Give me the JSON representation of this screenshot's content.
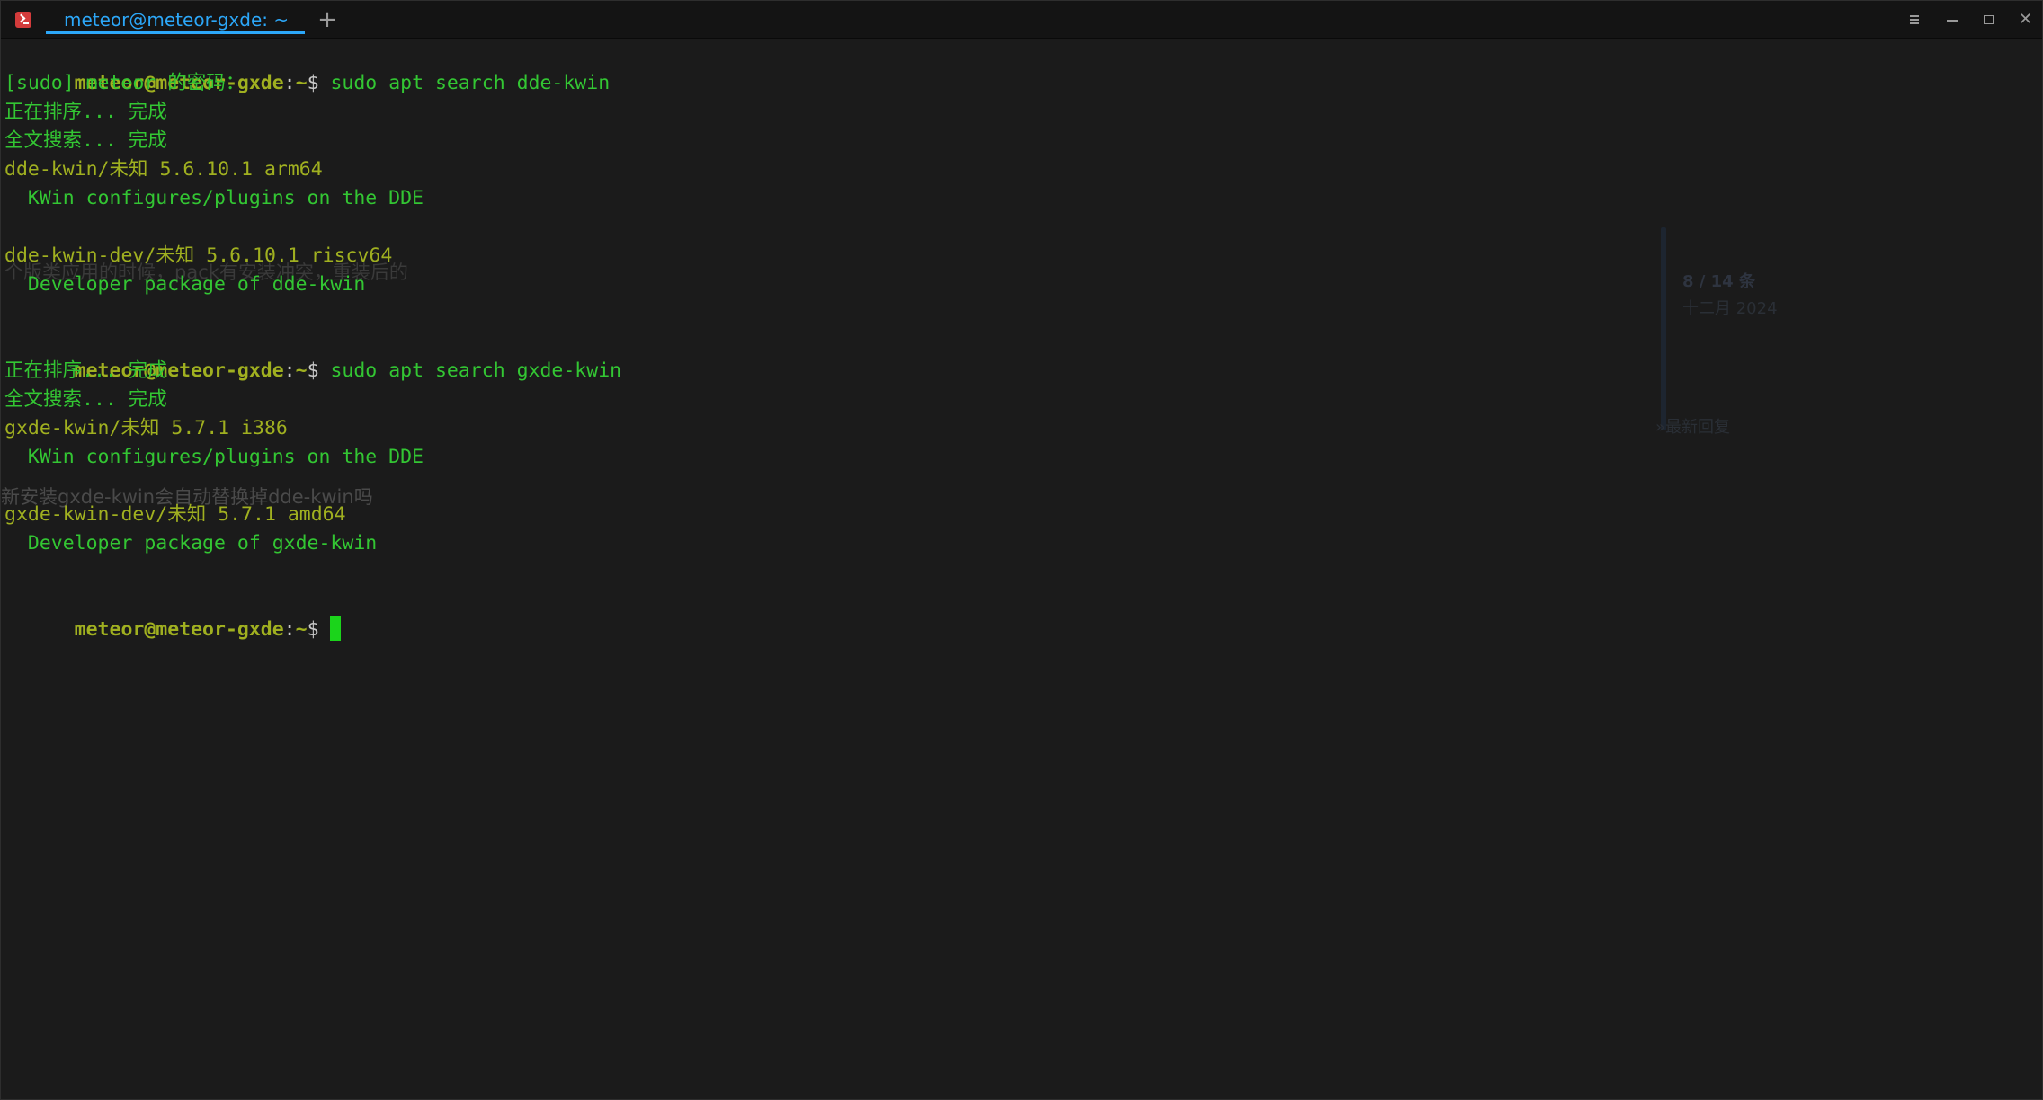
{
  "window": {
    "tab_title": "meteor@meteor-gxde: ~",
    "add_tab_symbol": "+",
    "close_symbol": "✕"
  },
  "terminal": {
    "prompt": {
      "user_host": "meteor@meteor-gxde",
      "colon": ":",
      "path": "~",
      "dollar": "$"
    },
    "lines": {
      "l1_cmd": " sudo apt search dde-kwin",
      "l2": "[sudo] meteor 的密码：",
      "l3": "正在排序... 完成",
      "l4": "全文搜索... 完成",
      "l5_pkg": "dde-kwin/未知 5.6.10.1 arm64",
      "l6": "  KWin configures/plugins on the DDE",
      "l8_pkg": "dde-kwin-dev/未知 5.6.10.1 riscv64",
      "l9": "  Developer package of dde-kwin",
      "l11_cmd": " sudo apt search gxde-kwin",
      "l12": "正在排序... 完成",
      "l13": "全文搜索... 完成",
      "l14_pkg": "gxde-kwin/未知 5.7.1 i386",
      "l15": "  KWin configures/plugins on the DDE",
      "l17_pkg": "gxde-kwin-dev/未知 5.7.1 amd64",
      "l18": "  Developer package of gxde-kwin",
      "l20_cmd": " "
    }
  },
  "background_ghost": {
    "text1": "个版类应用的时候，pack有安装冲突，重装后的",
    "text2": "新安装gxde-kwin会自动替换掉dde-kwin吗",
    "counter": "8 / 14 条",
    "date": "十二月 2024",
    "latest_reply": "最新回复"
  },
  "colors": {
    "background": "#1b1b1b",
    "titlebar": "#141414",
    "accent": "#2ca7f8",
    "prompt": "#a0b020",
    "output_green": "#33c633",
    "cursor": "#1bd41b"
  }
}
